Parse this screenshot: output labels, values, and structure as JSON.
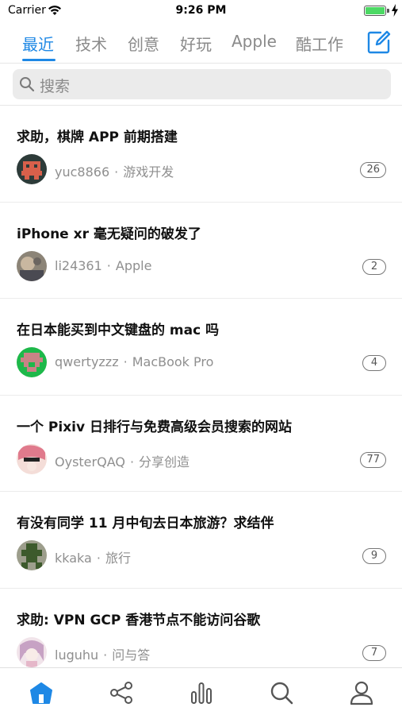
{
  "status_bar": {
    "carrier": "Carrier",
    "time": "9:26 PM",
    "battery_color": "#4cd964",
    "icons": [
      "wifi-icon",
      "battery-icon",
      "charging-bolt-icon"
    ]
  },
  "tabs": {
    "items": [
      {
        "label": "最近",
        "active": true
      },
      {
        "label": "技术",
        "active": false
      },
      {
        "label": "创意",
        "active": false
      },
      {
        "label": "好玩",
        "active": false
      },
      {
        "label": "Apple",
        "active": false
      },
      {
        "label": "酷工作",
        "active": false
      }
    ],
    "accent_color": "#1e88e5",
    "compose_icon": "compose-icon"
  },
  "search": {
    "placeholder": "搜索",
    "icon": "search-icon"
  },
  "posts": [
    {
      "title": "求助，棋牌 APP 前期搭建",
      "author": "yuc8866",
      "node": "游戏开发",
      "replies": "26"
    },
    {
      "title": "iPhone xr 毫无疑问的破发了",
      "author": "li24361",
      "node": "Apple",
      "replies": "2"
    },
    {
      "title": "在日本能买到中文键盘的 mac 吗",
      "author": "qwertyzzz",
      "node": "MacBook Pro",
      "replies": "4"
    },
    {
      "title": "一个 Pixiv 日排行与免费高级会员搜索的网站",
      "author": "OysterQAQ",
      "node": "分享创造",
      "replies": "77"
    },
    {
      "title": "有没有同学 11 月中旬去日本旅游？求结伴",
      "author": "kkaka",
      "node": "旅行",
      "replies": "9"
    },
    {
      "title": "求助: VPN GCP 香港节点不能访问谷歌",
      "author": "luguhu",
      "node": "问与答",
      "replies": "7"
    }
  ],
  "bottom_nav": {
    "items": [
      {
        "icon": "home-icon",
        "active": true
      },
      {
        "icon": "share-nodes-icon",
        "active": false
      },
      {
        "icon": "bar-chart-icon",
        "active": false
      },
      {
        "icon": "search-icon",
        "active": false
      },
      {
        "icon": "profile-icon",
        "active": false
      }
    ]
  },
  "separator": "·"
}
